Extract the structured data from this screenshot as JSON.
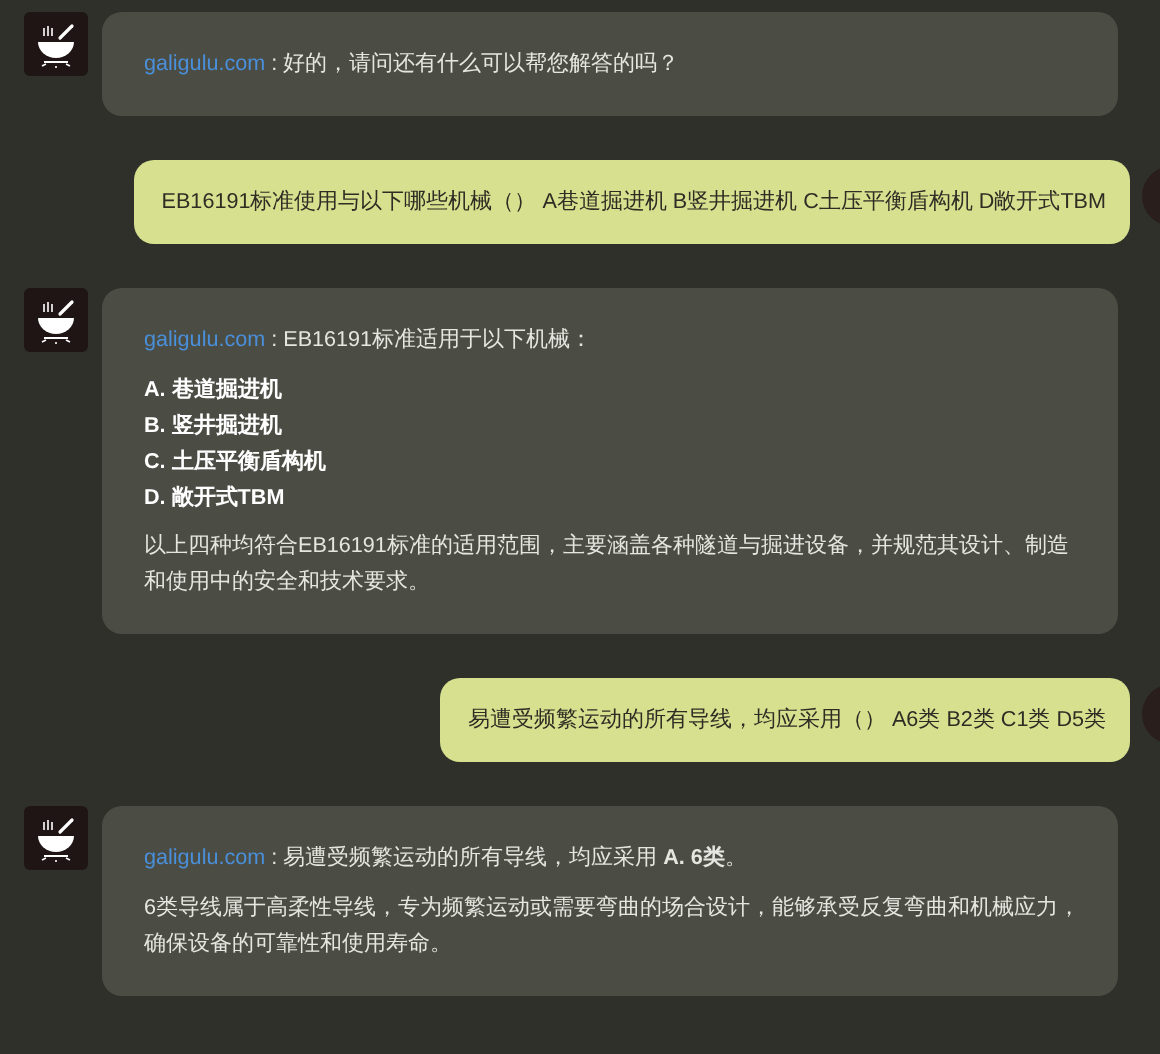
{
  "messages": [
    {
      "kind": "bot",
      "source": "galigulu.com",
      "lead": ": 好的，请问还有什么可以帮您解答的吗？"
    },
    {
      "kind": "user",
      "text": "EB16191标准使用与以下哪些机械（） A巷道掘进机 B竖井掘进机 C土压平衡盾构机 D敞开式TBM"
    },
    {
      "kind": "bot",
      "source": "galigulu.com",
      "lead": ": EB16191标准适用于以下机械：",
      "items": [
        "A. 巷道掘进机",
        "B. 竖井掘进机",
        "C. 土压平衡盾构机",
        "D. 敞开式TBM"
      ],
      "paragraphs": [
        "以上四种均符合EB16191标准的适用范围，主要涵盖各种隧道与掘进设备，并规范其设计、制造和使用中的安全和技术要求。"
      ]
    },
    {
      "kind": "user",
      "text": "易遭受频繁运动的所有导线，均应采用（） A6类 B2类 C1类 D5类"
    },
    {
      "kind": "bot",
      "source": "galigulu.com",
      "lead": ": 易遭受频繁运动的所有导线，均应采用 **A. 6类**。",
      "paragraphs": [
        "6类导线属于高柔性导线，专为频繁运动或需要弯曲的场合设计，能够承受反复弯曲和机械应力，确保设备的可靠性和使用寿命。"
      ]
    }
  ]
}
